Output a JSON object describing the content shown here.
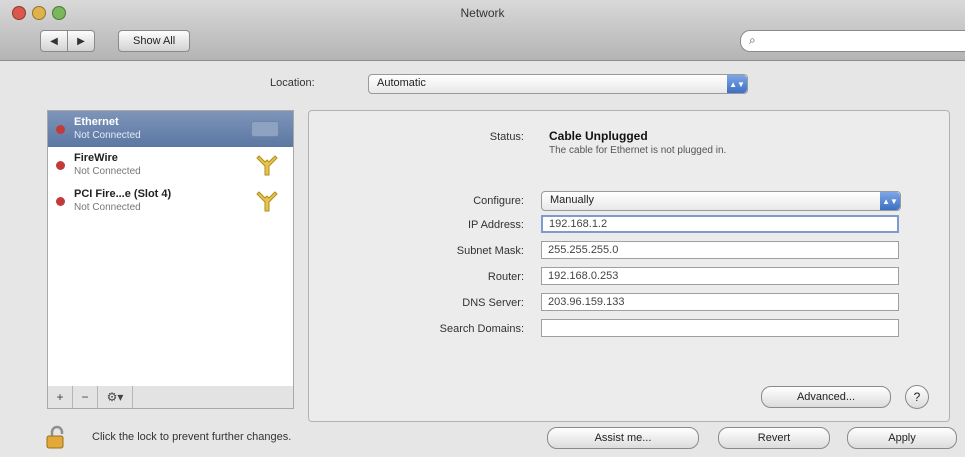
{
  "window": {
    "title": "Network"
  },
  "toolbar": {
    "show_all_label": "Show All",
    "search_placeholder": ""
  },
  "location": {
    "label": "Location:",
    "value": "Automatic"
  },
  "services": [
    {
      "name": "Ethernet",
      "status": "Not Connected",
      "dot_color": "#c43a3a",
      "icon": "ethernet-icon",
      "selected": true
    },
    {
      "name": "FireWire",
      "status": "Not Connected",
      "dot_color": "#c43a3a",
      "icon": "firewire-icon",
      "selected": false
    },
    {
      "name": "PCI Fire...e (Slot 4)",
      "status": "Not Connected",
      "dot_color": "#c43a3a",
      "icon": "firewire-icon",
      "selected": false
    }
  ],
  "sidebar_footer": {
    "add": "+",
    "remove": "−",
    "gear": "⚙▾"
  },
  "detail": {
    "status_label": "Status:",
    "status_value": "Cable Unplugged",
    "status_description": "The cable for Ethernet is not plugged in.",
    "configure_label": "Configure:",
    "configure_value": "Manually",
    "ip_label": "IP Address:",
    "ip_value": "192.168.1.2",
    "subnet_label": "Subnet Mask:",
    "subnet_value": "255.255.255.0",
    "router_label": "Router:",
    "router_value": "192.168.0.253",
    "dns_label": "DNS Server:",
    "dns_value": "203.96.159.133",
    "search_domains_label": "Search Domains:",
    "search_domains_value": "",
    "advanced_label": "Advanced...",
    "help_label": "?"
  },
  "bottom": {
    "lock_text": "Click the lock to prevent further changes.",
    "assist_label": "Assist me...",
    "revert_label": "Revert",
    "apply_label": "Apply"
  },
  "colors": {
    "accent": "#5b77a3",
    "popup_arrow": "#3c6fc4",
    "disconnected": "#c43a3a"
  }
}
